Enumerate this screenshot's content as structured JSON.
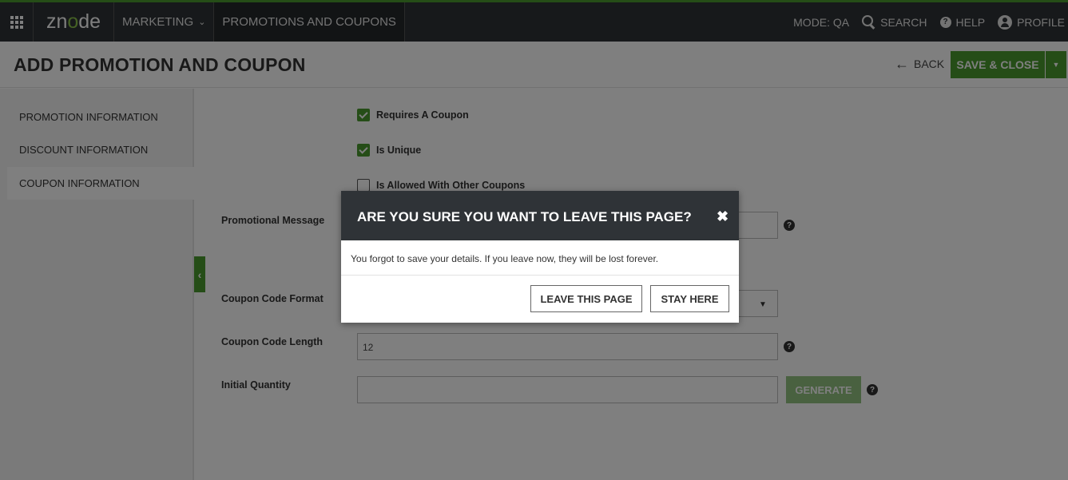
{
  "topbar": {
    "logo": {
      "pre": "zn",
      "o": "o",
      "post": "de"
    },
    "menu_marketing": "MARKETING",
    "menu_promotions": "PROMOTIONS AND COUPONS",
    "mode": "MODE: QA",
    "search": "SEARCH",
    "help": "HELP",
    "profile": "PROFILE"
  },
  "header": {
    "title": "ADD PROMOTION AND COUPON",
    "back": "BACK",
    "save_close": "SAVE & CLOSE"
  },
  "sidebar": {
    "items": [
      {
        "label": "PROMOTION INFORMATION",
        "active": false
      },
      {
        "label": "DISCOUNT INFORMATION",
        "active": false
      },
      {
        "label": "COUPON INFORMATION",
        "active": true
      }
    ]
  },
  "form": {
    "checkboxes": [
      {
        "label": "Requires A Coupon",
        "checked": true
      },
      {
        "label": "Is Unique",
        "checked": true
      },
      {
        "label": "Is Allowed With Other Coupons",
        "checked": false
      }
    ],
    "promotional_message_label": "Promotional Message",
    "coupon_code_format_label": "Coupon Code Format",
    "coupon_code_length_label": "Coupon Code Length",
    "coupon_code_length_value": "12",
    "initial_quantity_label": "Initial Quantity",
    "initial_quantity_value": "",
    "generate": "GENERATE"
  },
  "modal": {
    "title": "ARE YOU SURE YOU WANT TO LEAVE THIS PAGE?",
    "message": "You forgot to save your details. If you leave now, they will be lost forever.",
    "leave": "LEAVE THIS PAGE",
    "stay": "STAY HERE"
  },
  "colors": {
    "accent": "#4a9a2f",
    "topbar": "#2f3337",
    "overlay": "rgba(0,0,0,0.5)"
  },
  "icons": [
    "apps-grid-icon",
    "chevron-down-icon",
    "search-icon",
    "help-icon",
    "user-icon",
    "arrow-left-icon",
    "caret-down-icon",
    "check-icon",
    "close-icon",
    "chevron-left-icon"
  ]
}
